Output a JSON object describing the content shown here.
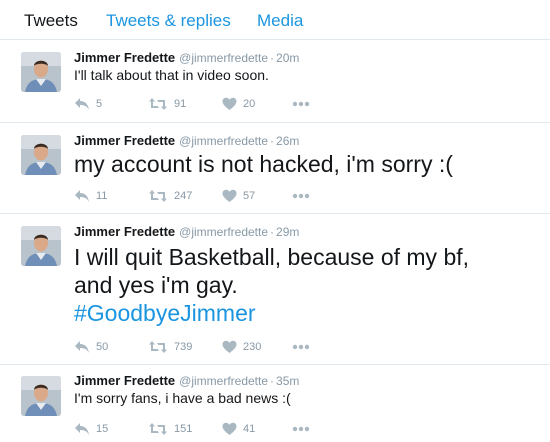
{
  "tabs": [
    {
      "label": "Tweets"
    },
    {
      "label": "Tweets & replies"
    },
    {
      "label": "Media"
    }
  ],
  "colors": {
    "accent": "#1b95e0",
    "muted": "#8899a6",
    "icon": "#aab8c2",
    "border": "#e1e8ed"
  },
  "icons": {
    "reply": "reply-icon",
    "retweet": "retweet-icon",
    "like": "heart-icon",
    "more": "more-dots-icon"
  },
  "tweets": [
    {
      "name": "Jimmer Fredette",
      "handle": "@jimmerfredette",
      "sep": "·",
      "time": "20m",
      "text_lines": [
        "I'll talk about that in video soon."
      ],
      "hashtag": "",
      "replies": "5",
      "retweets": "91",
      "likes": "20"
    },
    {
      "name": "Jimmer Fredette",
      "handle": "@jimmerfredette",
      "sep": "·",
      "time": "26m",
      "text_lines": [
        "my account is not hacked, i'm sorry :("
      ],
      "hashtag": "",
      "replies": "11",
      "retweets": "247",
      "likes": "57"
    },
    {
      "name": "Jimmer Fredette",
      "handle": "@jimmerfredette",
      "sep": "·",
      "time": "29m",
      "text_lines": [
        "I will quit Basketball, because of my bf,",
        "and yes i'm gay."
      ],
      "hashtag": "#GoodbyeJimmer",
      "replies": "50",
      "retweets": "739",
      "likes": "230"
    },
    {
      "name": "Jimmer Fredette",
      "handle": "@jimmerfredette",
      "sep": "·",
      "time": "35m",
      "text_lines": [
        "I'm sorry fans, i have a bad news :("
      ],
      "hashtag": "",
      "replies": "15",
      "retweets": "151",
      "likes": "41"
    }
  ]
}
